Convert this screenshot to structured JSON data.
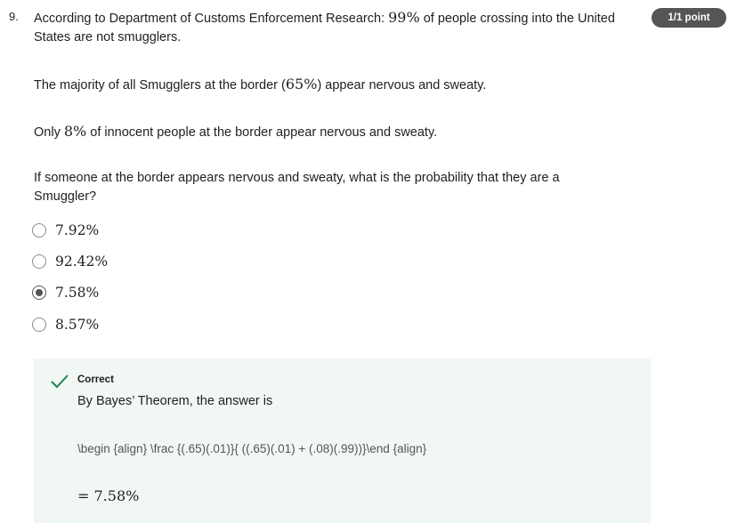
{
  "question": {
    "number": "9.",
    "points": "1/1 point",
    "line1_pre": "According to Department of Customs Enforcement Research: ",
    "line1_math": "99%",
    "line1_post": " of people crossing into the United States are not smugglers.",
    "line2_pre": "The majority of all Smugglers at the border (",
    "line2_math": "65%",
    "line2_post": ") appear nervous and sweaty.",
    "line3_pre": "Only ",
    "line3_math": "8%",
    "line3_post": " of innocent people at the border appear nervous and sweaty.",
    "prompt": "If someone at the border appears nervous and sweaty, what is the probability that they are a Smuggler?"
  },
  "options": [
    {
      "label": "7.92%",
      "selected": false
    },
    {
      "label": "92.42%",
      "selected": false
    },
    {
      "label": "7.58%",
      "selected": true
    },
    {
      "label": "8.57%",
      "selected": false
    }
  ],
  "feedback": {
    "status": "Correct",
    "text": "By Bayes’ Theorem, the answer is",
    "formula": "\\begin {align} \\frac {(.65)(.01)}{ ((.65)(.01) + (.08)(.99))}\\end {align}",
    "result": "= 7.58%",
    "icon": "check-icon",
    "accent_color": "#1f8354",
    "background_color": "#f1f8f4"
  }
}
